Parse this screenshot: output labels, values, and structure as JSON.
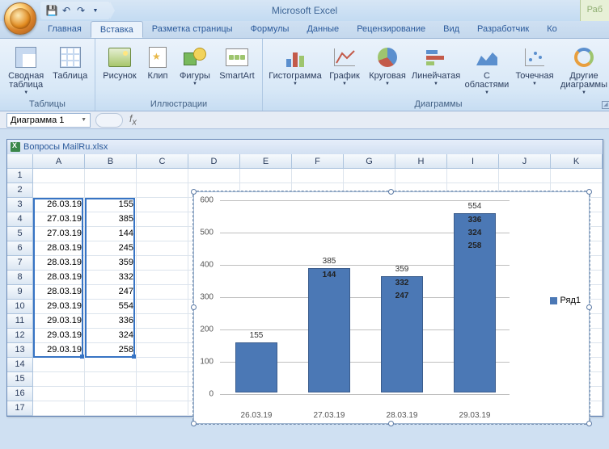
{
  "app_title": "Microsoft Excel",
  "context_tab": "Раб",
  "ribbon_tabs": [
    "Главная",
    "Вставка",
    "Разметка страницы",
    "Формулы",
    "Данные",
    "Рецензирование",
    "Вид",
    "Разработчик",
    "Ко"
  ],
  "active_tab_index": 1,
  "groups": {
    "tables": {
      "label": "Таблицы",
      "pivot": "Сводная\nтаблица",
      "table": "Таблица"
    },
    "illus": {
      "label": "Иллюстрации",
      "pic": "Рисунок",
      "clip": "Клип",
      "shapes": "Фигуры",
      "smart": "SmartArt"
    },
    "charts": {
      "label": "Диаграммы",
      "hist": "Гистограмма",
      "line": "График",
      "pie": "Круговая",
      "barh": "Линейчатая",
      "area": "С\nобластями",
      "scatter": "Точечная",
      "other": "Другие\nдиаграммы"
    }
  },
  "namebox": "Диаграмма 1",
  "workbook_title": "Вопросы MailRu.xlsx",
  "columns": [
    "A",
    "B",
    "C",
    "D",
    "E",
    "F",
    "G",
    "H",
    "I",
    "J",
    "K"
  ],
  "table_data": [
    {
      "r": 3,
      "a": "26.03.19",
      "b": 155
    },
    {
      "r": 4,
      "a": "27.03.19",
      "b": 385
    },
    {
      "r": 5,
      "a": "27.03.19",
      "b": 144
    },
    {
      "r": 6,
      "a": "28.03.19",
      "b": 245
    },
    {
      "r": 7,
      "a": "28.03.19",
      "b": 359
    },
    {
      "r": 8,
      "a": "28.03.19",
      "b": 332
    },
    {
      "r": 9,
      "a": "28.03.19",
      "b": 247
    },
    {
      "r": 10,
      "a": "29.03.19",
      "b": 554
    },
    {
      "r": 11,
      "a": "29.03.19",
      "b": 336
    },
    {
      "r": 12,
      "a": "29.03.19",
      "b": 324
    },
    {
      "r": 13,
      "a": "29.03.19",
      "b": 258
    }
  ],
  "chart_data": {
    "type": "bar",
    "categories": [
      "26.03.19",
      "27.03.19",
      "28.03.19",
      "29.03.19"
    ],
    "values": [
      155,
      385,
      359,
      554
    ],
    "stacked_labels": [
      [],
      [
        144
      ],
      [
        332,
        247
      ],
      [
        336,
        324,
        258
      ]
    ],
    "series_name": "Ряд1",
    "ylim": [
      0,
      600
    ],
    "ystep": 100,
    "title": "",
    "xlabel": "",
    "ylabel": ""
  }
}
